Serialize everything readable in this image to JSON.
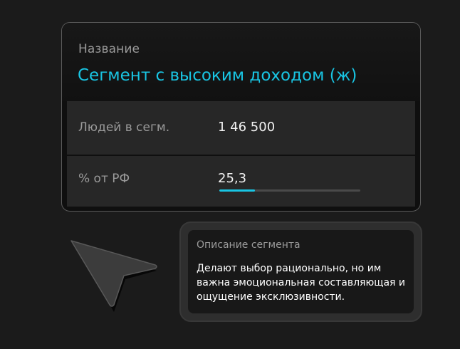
{
  "segment_card": {
    "name_label": "Название",
    "name_value": "Сегмент с высоким доходом (ж)",
    "accent_color": "#19c5e3",
    "rows": [
      {
        "label": "Людей в сегм.",
        "value": "1 46 500"
      },
      {
        "label": "% от РФ",
        "value": "25,3",
        "progress_percent": 25.3
      }
    ]
  },
  "description_card": {
    "title": "Описание сегмента",
    "text": "Делают выбор рационально, но им важна эмоциональная составляющая и ощущение эксклюзивности."
  },
  "cursor": {
    "icon": "pointer-arrow-icon"
  }
}
